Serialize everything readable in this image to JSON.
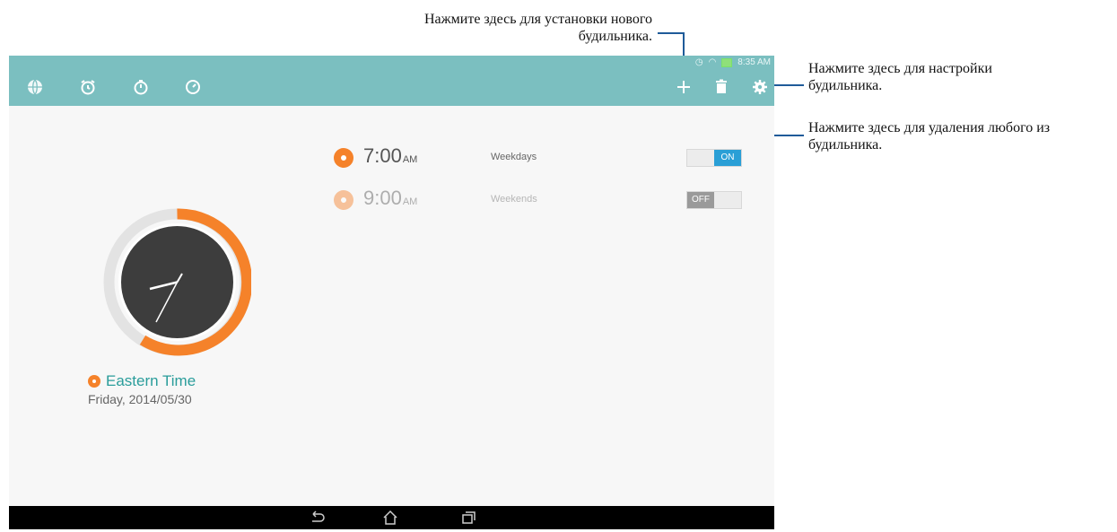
{
  "callouts": {
    "add": "Нажмите здесь для установки нового будильника.",
    "settings": "Нажмите здесь для настройки будильника.",
    "delete": "Нажмите здесь для удаления любого из будильника."
  },
  "status_bar": {
    "time": "8:35 AM"
  },
  "tabs": [
    {
      "icon": "globe-icon",
      "label": "World clock"
    },
    {
      "icon": "alarm-clock-icon",
      "label": "Alarm"
    },
    {
      "icon": "stopwatch-icon",
      "label": "Stopwatch"
    },
    {
      "icon": "timer-icon",
      "label": "Timer"
    }
  ],
  "actions": [
    {
      "icon": "plus-icon"
    },
    {
      "icon": "trash-icon"
    },
    {
      "icon": "gear-icon"
    }
  ],
  "alarms": [
    {
      "time": "7:00",
      "ampm": "AM",
      "days": "Weekdays",
      "enabled": true,
      "toggle_label": "ON"
    },
    {
      "time": "9:00",
      "ampm": "AM",
      "days": "Weekends",
      "enabled": false,
      "toggle_label": "OFF"
    }
  ],
  "clock": {
    "timezone": "Eastern Time",
    "date": "Friday, 2014/05/30"
  },
  "colors": {
    "accent": "#f5822a",
    "appbar": "#7bbfc0",
    "teal_text": "#2a9d9b",
    "toggle_on": "#2a9fd6"
  },
  "navbar": [
    {
      "icon": "back-icon"
    },
    {
      "icon": "home-icon"
    },
    {
      "icon": "recents-icon"
    }
  ]
}
